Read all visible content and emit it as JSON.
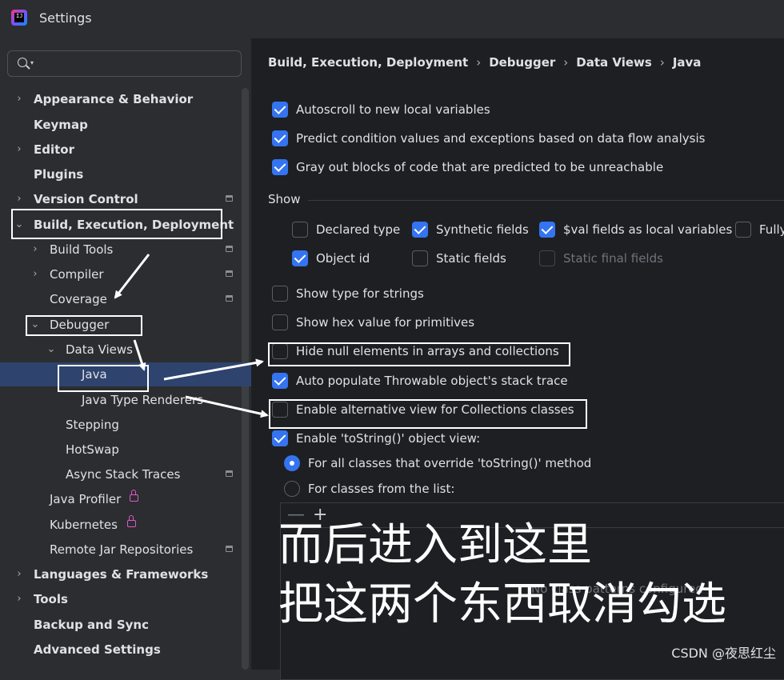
{
  "window": {
    "title": "Settings"
  },
  "search": {
    "placeholder": ""
  },
  "sidebar": {
    "items": [
      {
        "label": "Appearance & Behavior"
      },
      {
        "label": "Keymap"
      },
      {
        "label": "Editor"
      },
      {
        "label": "Plugins"
      },
      {
        "label": "Version Control"
      },
      {
        "label": "Build, Execution, Deployment"
      },
      {
        "label": "Build Tools"
      },
      {
        "label": "Compiler"
      },
      {
        "label": "Coverage"
      },
      {
        "label": "Debugger"
      },
      {
        "label": "Data Views"
      },
      {
        "label": "Java"
      },
      {
        "label": "Java Type Renderers"
      },
      {
        "label": "Stepping"
      },
      {
        "label": "HotSwap"
      },
      {
        "label": "Async Stack Traces"
      },
      {
        "label": "Java Profiler"
      },
      {
        "label": "Kubernetes"
      },
      {
        "label": "Remote Jar Repositories"
      },
      {
        "label": "Languages & Frameworks"
      },
      {
        "label": "Tools"
      },
      {
        "label": "Backup and Sync"
      },
      {
        "label": "Advanced Settings"
      }
    ]
  },
  "breadcrumb": [
    "Build, Execution, Deployment",
    "Debugger",
    "Data Views",
    "Java"
  ],
  "options": {
    "autoscroll": {
      "label": "Autoscroll to new local variables",
      "checked": true
    },
    "predict": {
      "label": "Predict condition values and exceptions based on data flow analysis",
      "checked": true
    },
    "grayout": {
      "label": "Gray out blocks of code that are predicted to be unreachable",
      "checked": true
    },
    "show_type_strings": {
      "label": "Show type for strings",
      "checked": false
    },
    "show_hex": {
      "label": "Show hex value for primitives",
      "checked": false
    },
    "hide_null": {
      "label": "Hide null elements in arrays and collections",
      "checked": false
    },
    "auto_populate": {
      "label": "Auto populate Throwable object's stack trace",
      "checked": true
    },
    "alt_view": {
      "label": "Enable alternative view for Collections classes",
      "checked": false
    },
    "tostring": {
      "label": "Enable 'toString()' object view:",
      "checked": true
    }
  },
  "show_section": {
    "title": "Show",
    "declared_type": {
      "label": "Declared type",
      "checked": false
    },
    "synthetic_fields": {
      "label": "Synthetic fields",
      "checked": true
    },
    "val_fields": {
      "label": "$val fields as local variables",
      "checked": true
    },
    "fully": {
      "label": "Fully",
      "checked": false
    },
    "object_id": {
      "label": "Object id",
      "checked": true
    },
    "static_fields": {
      "label": "Static fields",
      "checked": false
    },
    "static_final_fields": {
      "label": "Static final fields",
      "checked": false,
      "disabled": true
    }
  },
  "tostring_radio": {
    "all_classes": {
      "label": "For all classes that override 'toString()' method",
      "selected": true
    },
    "from_list": {
      "label": "For classes from the list:",
      "selected": false
    }
  },
  "class_list": {
    "remove_glyph": "—",
    "add_glyph": "+",
    "empty_text": "No class patterns configured"
  },
  "overlay": {
    "line1": "而后进入到这里",
    "line2": "把这两个东西取消勾选"
  },
  "watermark": "CSDN @夜思红尘"
}
